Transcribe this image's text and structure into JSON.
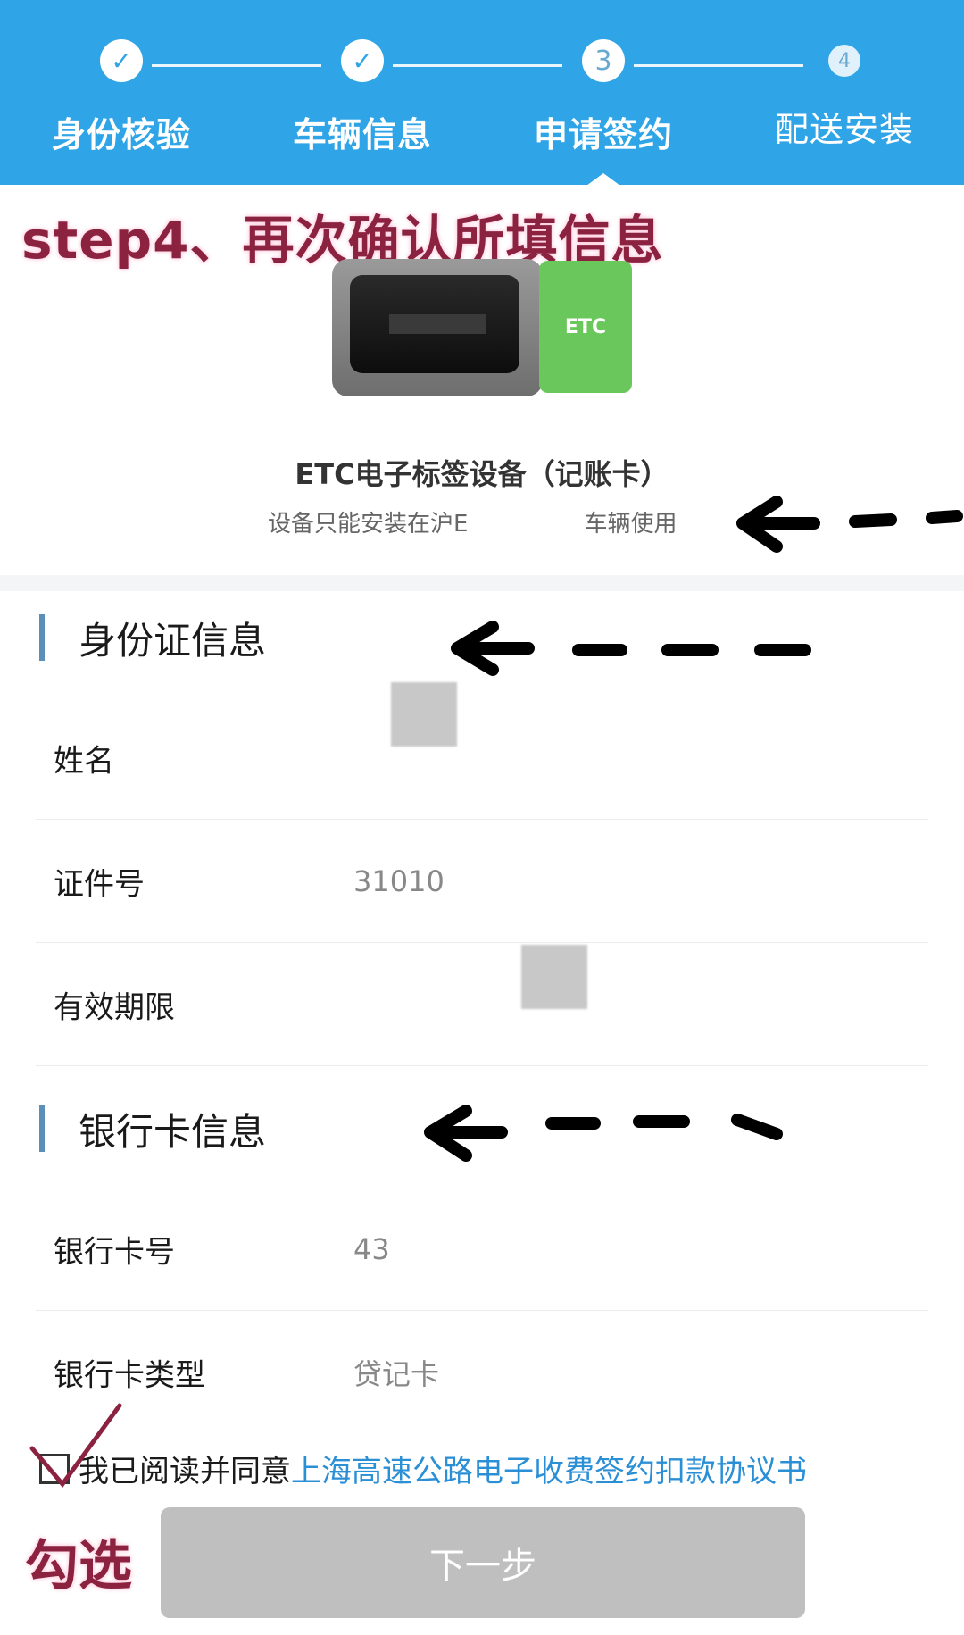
{
  "stepper": {
    "steps": [
      {
        "label": "身份核验",
        "mark": "✓",
        "state": "done"
      },
      {
        "label": "车辆信息",
        "mark": "✓",
        "state": "done"
      },
      {
        "label": "申请签约",
        "mark": "3",
        "state": "current"
      },
      {
        "label": "配送安装",
        "mark": "4",
        "state": "pending"
      }
    ],
    "accent_color": "#2fa4e6"
  },
  "annotation": {
    "step_note": "step4、再次确认所填信息",
    "check_note": "勾选"
  },
  "device": {
    "card_text": "ETC",
    "title": "ETC电子标签设备（记账卡）",
    "note_left": "设备只能安装在沪E",
    "note_right": "车辆使用"
  },
  "id_section": {
    "title": "身份证信息",
    "rows": [
      {
        "label": "姓名",
        "value": ""
      },
      {
        "label": "证件号",
        "value": "31010"
      },
      {
        "label": "有效期限",
        "value": ""
      }
    ]
  },
  "bank_section": {
    "title": "银行卡信息",
    "rows": [
      {
        "label": "银行卡号",
        "value": "43"
      },
      {
        "label": "银行卡类型",
        "value": "贷记卡"
      }
    ]
  },
  "agreement": {
    "prefix": "我已阅读并同意",
    "link": "上海高速公路电子收费签约扣款协议书",
    "checked": false
  },
  "next_button": {
    "label": "下一步",
    "enabled": false
  }
}
